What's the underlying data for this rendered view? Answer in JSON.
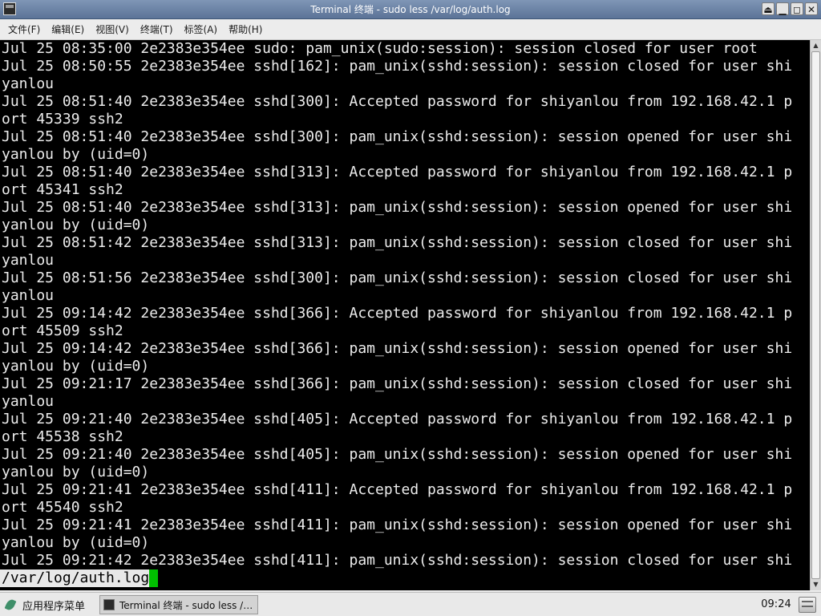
{
  "window": {
    "title": "Terminal 终端 - sudo less /var/log/auth.log",
    "controls": {
      "shade": "⏏",
      "minimize": "▁",
      "maximize": "◻",
      "close": "✕"
    }
  },
  "menubar": {
    "items": [
      {
        "label": "文件(F)"
      },
      {
        "label": "编辑(E)"
      },
      {
        "label": "视图(V)"
      },
      {
        "label": "终端(T)"
      },
      {
        "label": "标签(A)"
      },
      {
        "label": "帮助(H)"
      }
    ]
  },
  "terminal": {
    "lines": [
      "Jul 25 08:35:00 2e2383e354ee sudo: pam_unix(sudo:session): session closed for user root",
      "Jul 25 08:50:55 2e2383e354ee sshd[162]: pam_unix(sshd:session): session closed for user shi",
      "yanlou",
      "Jul 25 08:51:40 2e2383e354ee sshd[300]: Accepted password for shiyanlou from 192.168.42.1 p",
      "ort 45339 ssh2",
      "Jul 25 08:51:40 2e2383e354ee sshd[300]: pam_unix(sshd:session): session opened for user shi",
      "yanlou by (uid=0)",
      "Jul 25 08:51:40 2e2383e354ee sshd[313]: Accepted password for shiyanlou from 192.168.42.1 p",
      "ort 45341 ssh2",
      "Jul 25 08:51:40 2e2383e354ee sshd[313]: pam_unix(sshd:session): session opened for user shi",
      "yanlou by (uid=0)",
      "Jul 25 08:51:42 2e2383e354ee sshd[313]: pam_unix(sshd:session): session closed for user shi",
      "yanlou",
      "Jul 25 08:51:56 2e2383e354ee sshd[300]: pam_unix(sshd:session): session closed for user shi",
      "yanlou",
      "Jul 25 09:14:42 2e2383e354ee sshd[366]: Accepted password for shiyanlou from 192.168.42.1 p",
      "ort 45509 ssh2",
      "Jul 25 09:14:42 2e2383e354ee sshd[366]: pam_unix(sshd:session): session opened for user shi",
      "yanlou by (uid=0)",
      "Jul 25 09:21:17 2e2383e354ee sshd[366]: pam_unix(sshd:session): session closed for user shi",
      "yanlou",
      "Jul 25 09:21:40 2e2383e354ee sshd[405]: Accepted password for shiyanlou from 192.168.42.1 p",
      "ort 45538 ssh2",
      "Jul 25 09:21:40 2e2383e354ee sshd[405]: pam_unix(sshd:session): session opened for user shi",
      "yanlou by (uid=0)",
      "Jul 25 09:21:41 2e2383e354ee sshd[411]: Accepted password for shiyanlou from 192.168.42.1 p",
      "ort 45540 ssh2",
      "Jul 25 09:21:41 2e2383e354ee sshd[411]: pam_unix(sshd:session): session opened for user shi",
      "yanlou by (uid=0)",
      "Jul 25 09:21:42 2e2383e354ee sshd[411]: pam_unix(sshd:session): session closed for user shi"
    ],
    "prompt": "/var/log/auth.log",
    "colors": {
      "background": "#000000",
      "text": "#ececec",
      "cursor": "#00c000"
    }
  },
  "taskbar": {
    "start_label": "应用程序菜单",
    "task_label": "Terminal 终端 - sudo less /…",
    "clock": "09:24"
  }
}
